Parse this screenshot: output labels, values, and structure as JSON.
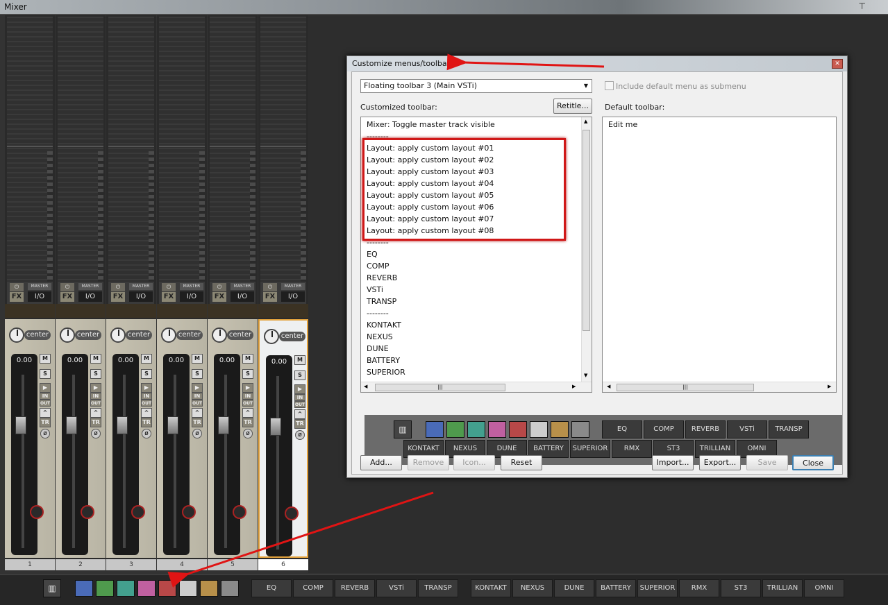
{
  "window": {
    "title": "Mixer"
  },
  "mixer": {
    "channels": [
      {
        "number": "1",
        "volume": "0.00",
        "pan": "center"
      },
      {
        "number": "2",
        "volume": "0.00",
        "pan": "center"
      },
      {
        "number": "3",
        "volume": "0.00",
        "pan": "center"
      },
      {
        "number": "4",
        "volume": "0.00",
        "pan": "center"
      },
      {
        "number": "5",
        "volume": "0.00",
        "pan": "center"
      },
      {
        "number": "6",
        "volume": "0.00",
        "pan": "center"
      }
    ],
    "labels": {
      "fx": "FX",
      "master": "MASTER",
      "io": "I/O",
      "mute": "M",
      "solo": "S",
      "in": "IN",
      "out": "OUT",
      "trim": "TR"
    }
  },
  "toolbar": {
    "colors": [
      "#4a6bb8",
      "#4f9a4d",
      "#43a08e",
      "#c060a0",
      "#b84848",
      "#cccccc",
      "#b8904a",
      "#8a8a8a"
    ],
    "row1": [
      "EQ",
      "COMP",
      "REVERB",
      "VSTi",
      "TRANSP"
    ],
    "row2": [
      "KONTAKT",
      "NEXUS",
      "DUNE",
      "BATTERY",
      "SUPERIOR",
      "RMX",
      "ST3",
      "TRILLIAN",
      "OMNI"
    ]
  },
  "dialog": {
    "title": "Customize menus/toolbars",
    "dropdown_value": "Floating toolbar 3 (Main VSTi)",
    "checkbox_label": "Include default menu as submenu",
    "customized_label": "Customized toolbar:",
    "retitle_label": "Retitle...",
    "default_label": "Default toolbar:",
    "customized_items": [
      "Mixer: Toggle master track visible",
      "--------",
      "Layout: apply custom layout #01",
      "Layout: apply custom layout #02",
      "Layout: apply custom layout #03",
      "Layout: apply custom layout #04",
      "Layout: apply custom layout #05",
      "Layout: apply custom layout #06",
      "Layout: apply custom layout #07",
      "Layout: apply custom layout #08",
      "--------",
      "EQ",
      "COMP",
      "REVERB",
      "VSTi",
      "TRANSP",
      "--------",
      "KONTAKT",
      "NEXUS",
      "DUNE",
      "BATTERY",
      "SUPERIOR"
    ],
    "default_items": [
      "Edit me"
    ],
    "buttons": {
      "add": "Add...",
      "remove": "Remove",
      "icon": "Icon...",
      "reset": "Reset",
      "import": "Import...",
      "export": "Export...",
      "save": "Save",
      "close": "Close"
    }
  }
}
